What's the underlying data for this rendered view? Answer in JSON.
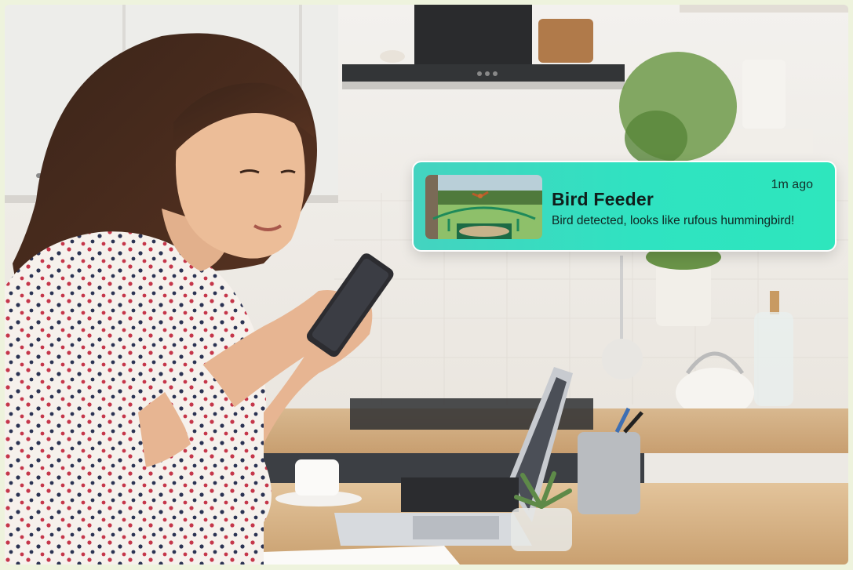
{
  "notification": {
    "title": "Bird Feeder",
    "time": "1m ago",
    "message": "Bird detected, looks like rufous hummingbird!",
    "thumbnail_icon": "hummingbird-feeder-thumbnail"
  },
  "colors": {
    "notification_start": "#44d3c0",
    "notification_end": "#2ee6bd",
    "border": "#eef3dd"
  }
}
